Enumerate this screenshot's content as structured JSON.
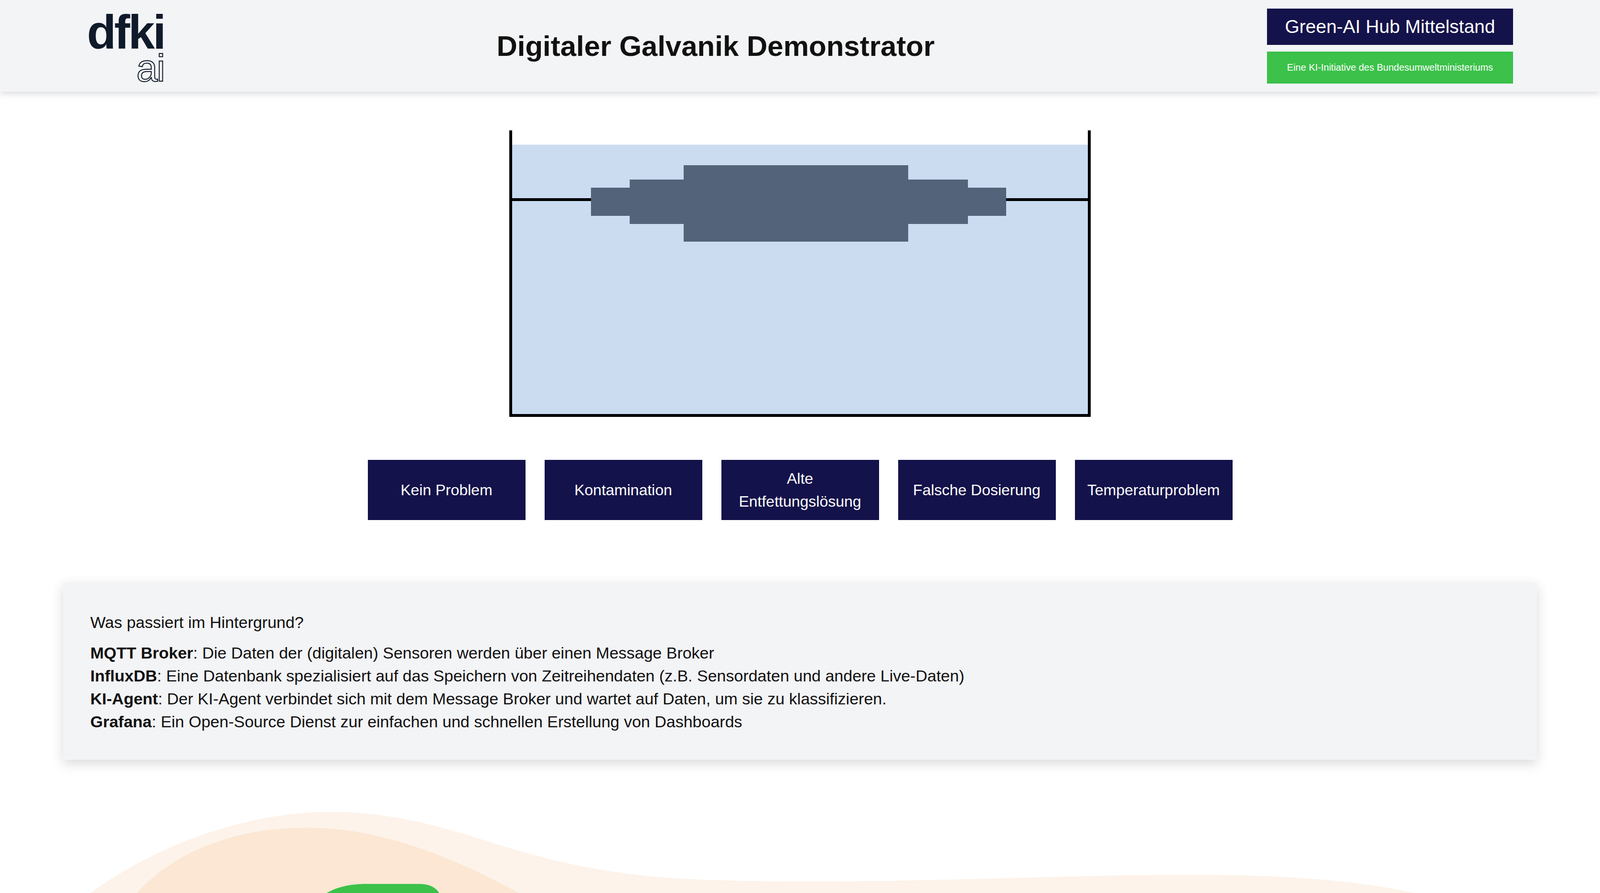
{
  "header": {
    "logo": {
      "top": "dfki",
      "bottom": "ai"
    },
    "title": "Digitaler Galvanik Demonstrator",
    "badge": {
      "title": "Green-AI Hub Mittelstand",
      "subtitle": "Eine KI-Initiative des Bundesumweltministeriums"
    }
  },
  "scenarios": [
    "Kein Problem",
    "Kontamination",
    "Alte Entfettungslösung",
    "Falsche Dosierung",
    "Temperaturproblem"
  ],
  "info": {
    "heading": "Was passiert im Hintergrund?",
    "items": [
      {
        "term": "MQTT Broker",
        "description": ": Die Daten der (digitalen) Sensoren werden über einen Message Broker"
      },
      {
        "term": "InfluxDB",
        "description": ": Eine Datenbank spezialisiert auf das Speichern von Zeitreihendaten (z.B. Sensordaten und andere Live-Daten)"
      },
      {
        "term": "KI-Agent",
        "description": ": Der KI-Agent verbindet sich mit dem Message Broker und wartet auf Daten, um sie zu klassifizieren."
      },
      {
        "term": "Grafana",
        "description": ": Ein Open-Source Dienst zur einfachen und schnellen Erstellung von Dashboards"
      }
    ]
  }
}
